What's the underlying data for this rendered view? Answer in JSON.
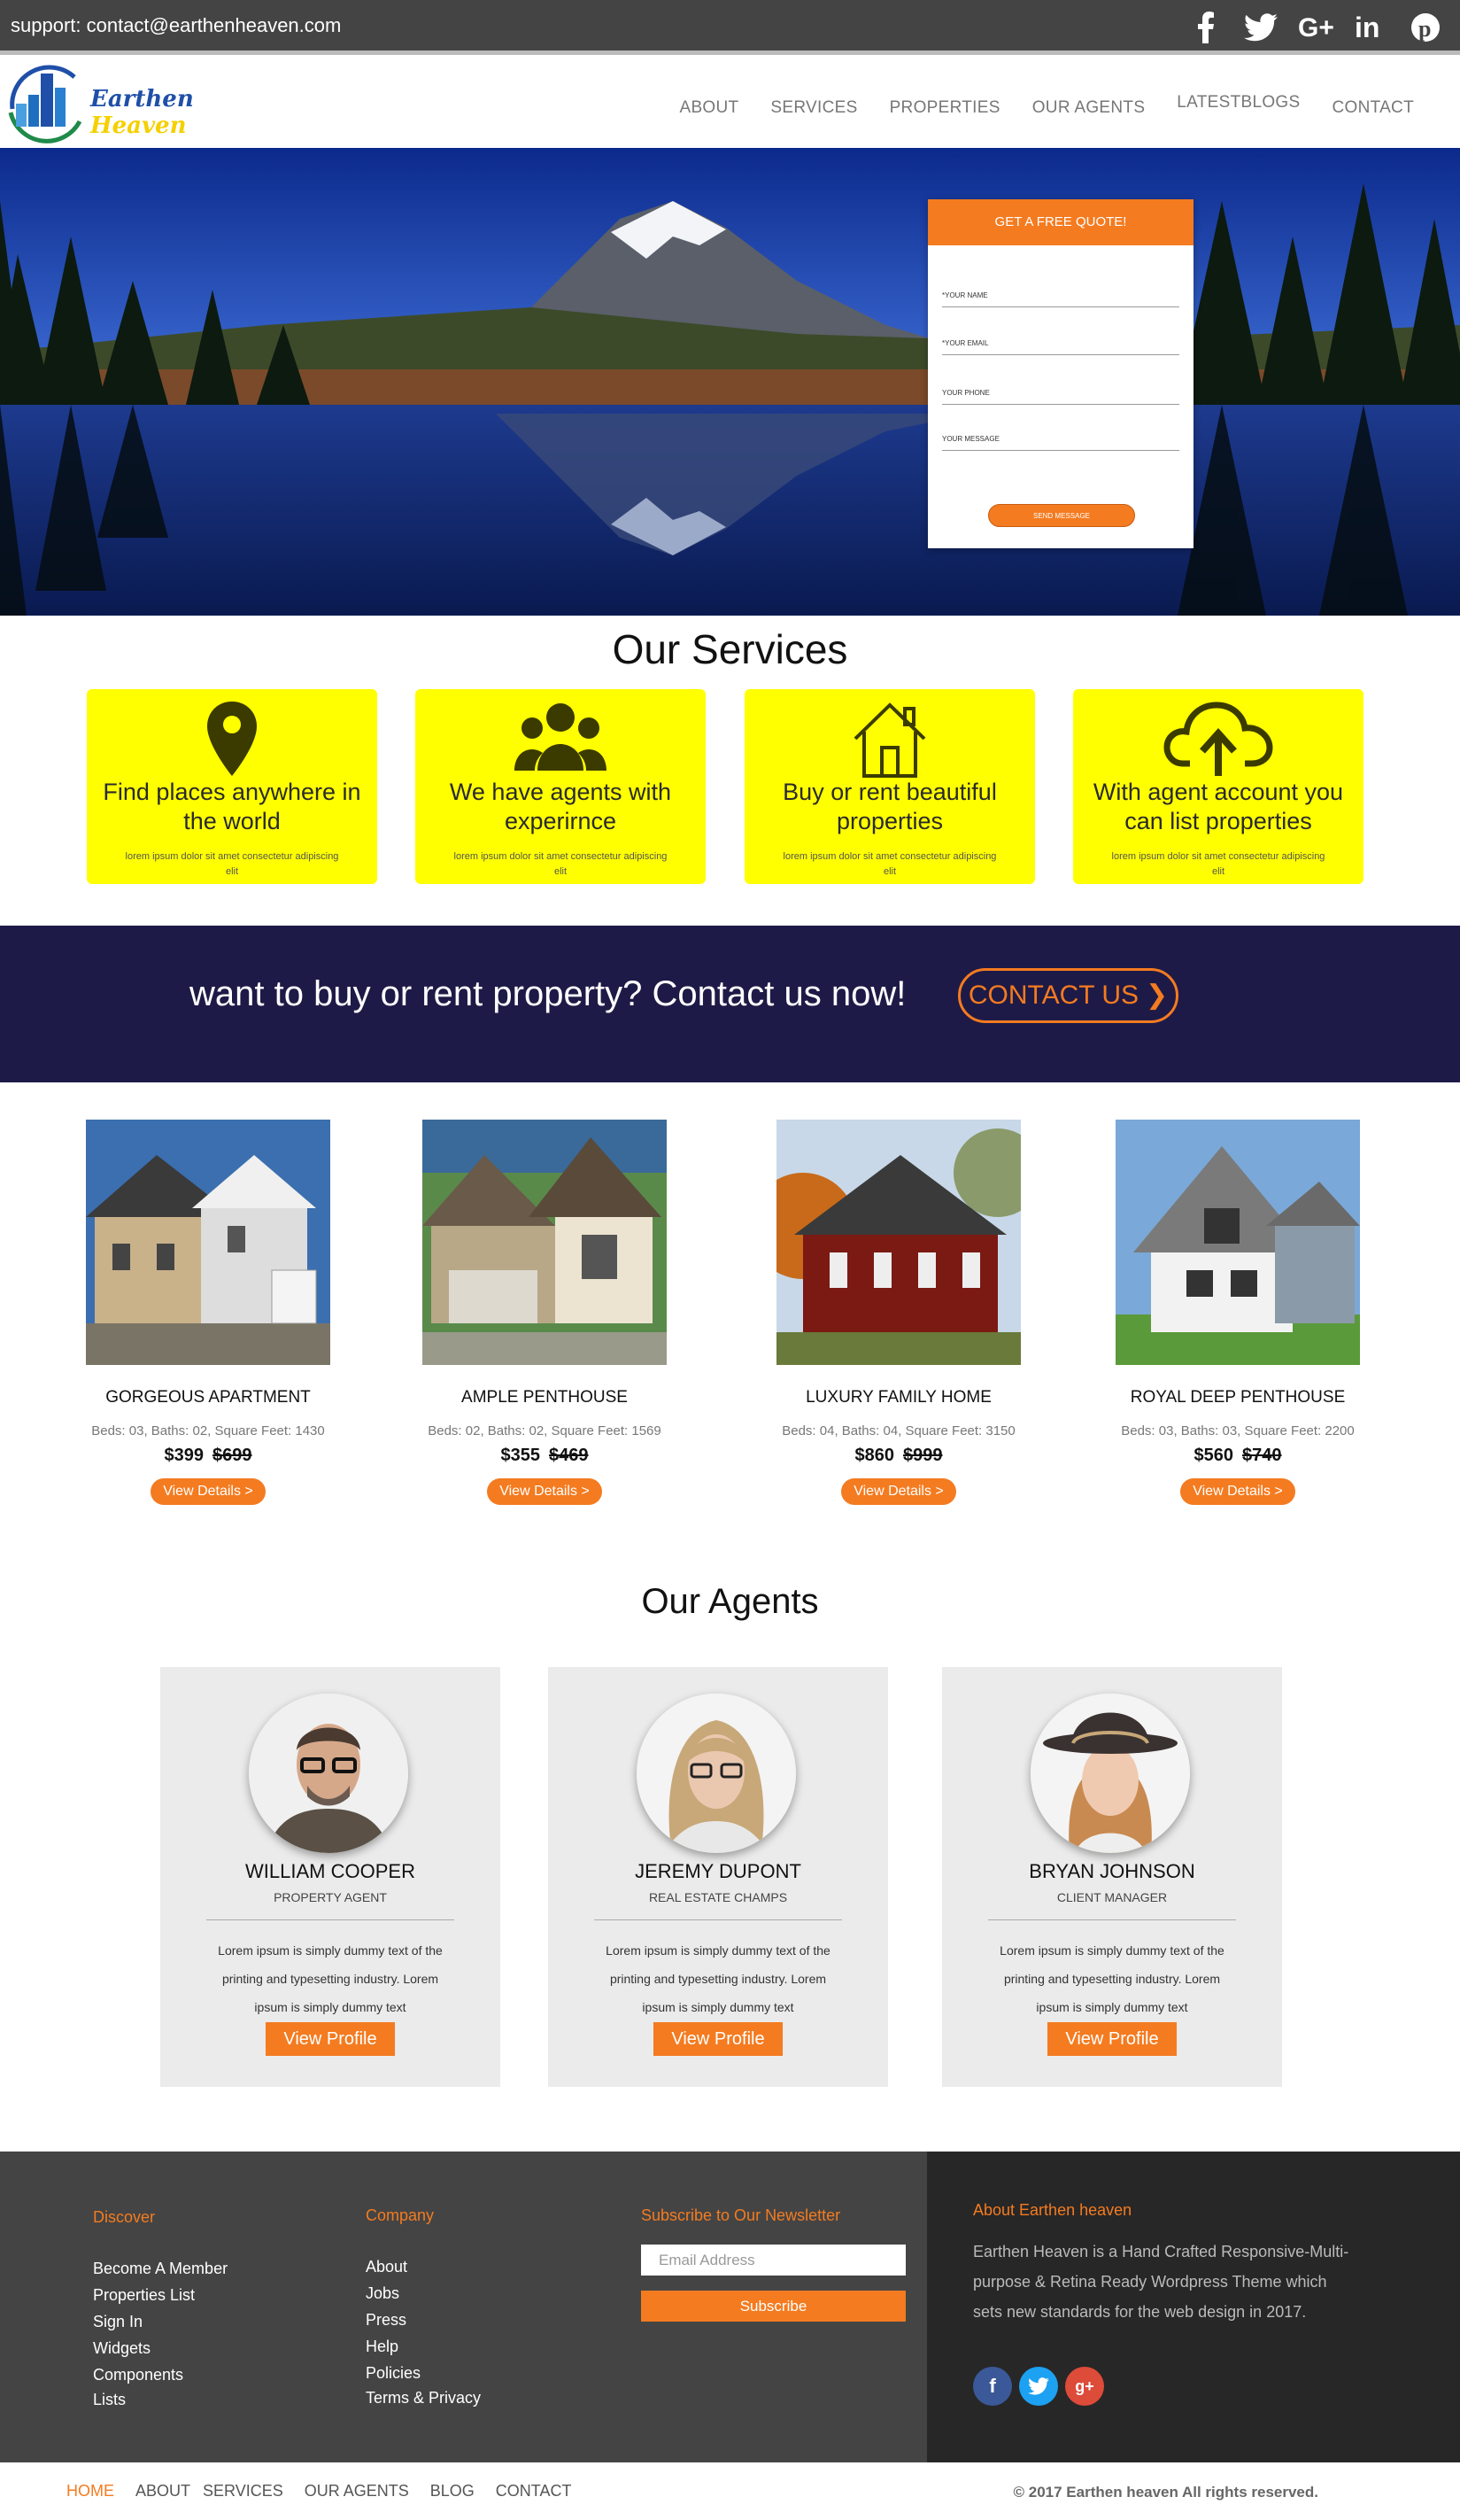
{
  "topbar": {
    "support": "support: contact@earthenheaven.com",
    "social_icons": [
      "facebook-icon",
      "twitter-icon",
      "google-plus-icon",
      "linkedin-icon",
      "pinterest-icon"
    ]
  },
  "brand": {
    "word1": "Earthen",
    "word2": "Heaven"
  },
  "nav": {
    "items": [
      "ABOUT",
      "SERVICES",
      "PROPERTIES",
      "OUR AGENTS",
      "LATESTBLOGS",
      "CONTACT"
    ]
  },
  "quote": {
    "title": "GET A FREE QUOTE!",
    "fields": [
      "*YOUR NAME",
      "*YOUR EMAIL",
      "YOUR PHONE",
      "YOUR MESSAGE"
    ],
    "button": "SEND MESSAGE"
  },
  "services": {
    "title": "Our Services",
    "cards": [
      {
        "title": "Find places anywhere in the world",
        "desc": "lorem ipsum dolor sit amet consectetur adipiscing elit",
        "icon": "map-pin-icon"
      },
      {
        "title": "We have agents with experirnce",
        "desc": "lorem ipsum dolor sit amet consectetur adipiscing elit",
        "icon": "users-icon"
      },
      {
        "title": "Buy or rent beautiful properties",
        "desc": "lorem ipsum dolor sit amet consectetur adipiscing elit",
        "icon": "house-icon"
      },
      {
        "title": "With agent account you can list properties",
        "desc": "lorem ipsum dolor sit amet consectetur adipiscing elit",
        "icon": "cloud-upload-icon"
      }
    ]
  },
  "cta": {
    "text": "want to buy or rent property? Contact us now!",
    "button": "CONTACT US"
  },
  "properties": [
    {
      "name": "GORGEOUS APARTMENT",
      "meta": "Beds: 03, Baths: 02, Square Feet: 1430",
      "price": "$399",
      "old_price": "$699",
      "button": "View Details >"
    },
    {
      "name": "AMPLE PENTHOUSE",
      "meta": "Beds: 02, Baths: 02, Square Feet: 1569",
      "price": "$355",
      "old_price": "$469",
      "button": "View Details >"
    },
    {
      "name": "LUXURY FAMILY HOME",
      "meta": "Beds: 04, Baths: 04, Square Feet: 3150",
      "price": "$860",
      "old_price": "$999",
      "button": "View Details >"
    },
    {
      "name": "ROYAL DEEP PENTHOUSE",
      "meta": "Beds: 03, Baths: 03, Square Feet: 2200",
      "price": "$560",
      "old_price": "$740",
      "button": "View Details >"
    }
  ],
  "agents": {
    "title": "Our Agents",
    "items": [
      {
        "name": "WILLIAM COOPER",
        "role": "PROPERTY AGENT",
        "bio": "Lorem ipsum is simply dummy text of the printing and typesetting industry. Lorem ipsum is simply dummy text",
        "button": "View Profile"
      },
      {
        "name": "JEREMY DUPONT",
        "role": "REAL ESTATE CHAMPS",
        "bio": "Lorem ipsum is simply dummy text of the printing and typesetting industry. Lorem ipsum is simply dummy text",
        "button": "View Profile"
      },
      {
        "name": "BRYAN JOHNSON",
        "role": "CLIENT MANAGER",
        "bio": "Lorem ipsum is simply dummy text of the printing and typesetting industry. Lorem ipsum is simply dummy text",
        "button": "View Profile"
      }
    ]
  },
  "footer": {
    "discover": {
      "title": "Discover",
      "links": [
        "Become A Member",
        "Properties List",
        "Sign In",
        "Widgets",
        "Components",
        "Lists"
      ]
    },
    "company": {
      "title": "Company",
      "links": [
        "About",
        "Jobs",
        "Press",
        "Help",
        "Policies",
        "Terms & Privacy"
      ]
    },
    "newsletter": {
      "title": "Subscribe to Our Newsletter",
      "placeholder": "Email Address",
      "button": "Subscribe"
    },
    "about": {
      "title": "About  Earthen heaven",
      "text": "Earthen Heaven is a Hand Crafted Responsive-Multi-purpose & Retina Ready Wordpress Theme which sets new standards for the web design in 2017.",
      "social": [
        "facebook-icon",
        "twitter-icon",
        "google-plus-icon"
      ]
    }
  },
  "bottom": {
    "nav": [
      "HOME",
      "ABOUT",
      "SERVICES",
      "OUR AGENTS",
      "BLOG",
      "CONTACT"
    ],
    "copyright": "© 2017 Earthen heaven All rights reserved."
  },
  "colors": {
    "accent": "#f47b20",
    "service_card": "#ffff00",
    "cta_bg": "#1e1a47",
    "footer_bg": "#444444",
    "footer_dark": "#272727"
  }
}
